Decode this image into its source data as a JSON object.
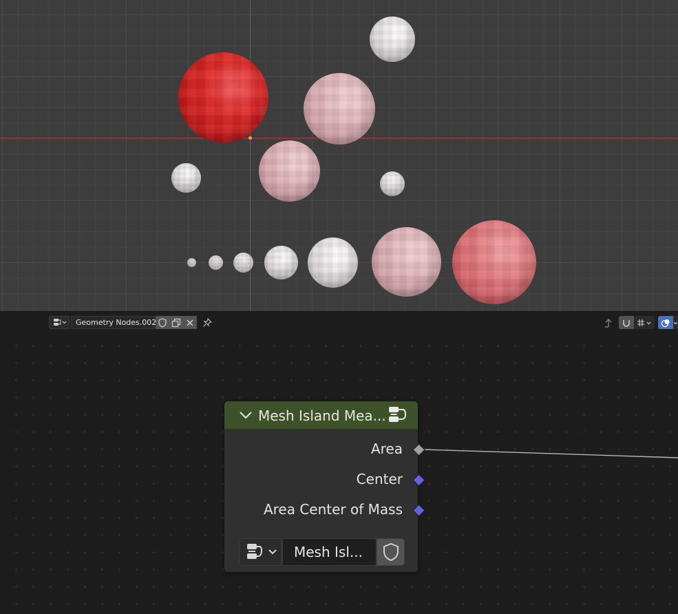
{
  "header": {
    "node_tree_name": "Geometry Nodes.002"
  },
  "node": {
    "title": "Mesh Island Mea...",
    "outputs": [
      {
        "label": "Area",
        "type": "float"
      },
      {
        "label": "Center",
        "type": "vector"
      },
      {
        "label": "Area Center of Mass",
        "type": "vector"
      }
    ],
    "group_selector_name": "Mesh Isl..."
  },
  "colors": {
    "node_header": "#3e5229",
    "socket_float": "#a0a0a0",
    "socket_vector": "#6661d6",
    "axis_x": "#a0353f",
    "axis_y": "#3c66a8",
    "origin": "#f2a130"
  },
  "icons": {
    "tree_type": "node-tree-icon",
    "fake_user": "shield-icon",
    "duplicate": "duplicate-icon",
    "unlink": "close-icon",
    "pin": "pin-icon",
    "parent": "arrow-up-icon",
    "snap": "magnet-icon",
    "overlay": "overlay-icon"
  }
}
